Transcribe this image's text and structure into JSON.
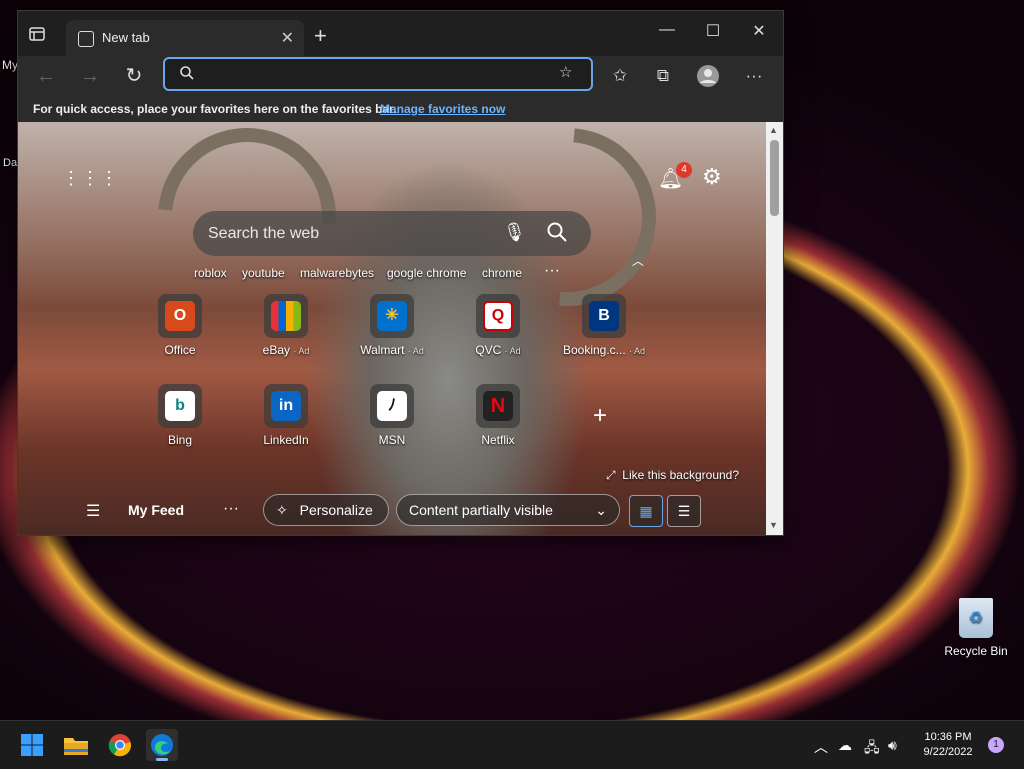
{
  "desktop": {
    "left_label_1": "My",
    "left_label_2": "Da",
    "recycle_bin_label": "Recycle Bin"
  },
  "browser": {
    "tab_title": "New tab",
    "address_value": "",
    "favorites_bar": {
      "message": "For quick access, place your favorites here on the favorites bar.",
      "link": "Manage favorites now"
    }
  },
  "newtab": {
    "notification_count": "4",
    "search_placeholder": "Search the web",
    "quick_searches": [
      "roblox",
      "youtube",
      "malwarebytes",
      "google chrome",
      "chrome"
    ],
    "tiles": [
      {
        "label": "Office",
        "ad": ""
      },
      {
        "label": "eBay",
        "ad": "· Ad"
      },
      {
        "label": "Walmart",
        "ad": "· Ad"
      },
      {
        "label": "QVC",
        "ad": "· Ad"
      },
      {
        "label": "Booking.c...",
        "ad": "· Ad"
      },
      {
        "label": "Bing",
        "ad": ""
      },
      {
        "label": "LinkedIn",
        "ad": ""
      },
      {
        "label": "MSN",
        "ad": ""
      },
      {
        "label": "Netflix",
        "ad": ""
      }
    ],
    "like_background": "Like this background?",
    "feed": {
      "title": "My Feed",
      "personalize": "Personalize",
      "content_select": "Content partially visible"
    }
  },
  "taskbar": {
    "time": "10:36 PM",
    "date": "9/22/2022",
    "notification_count": "1"
  }
}
